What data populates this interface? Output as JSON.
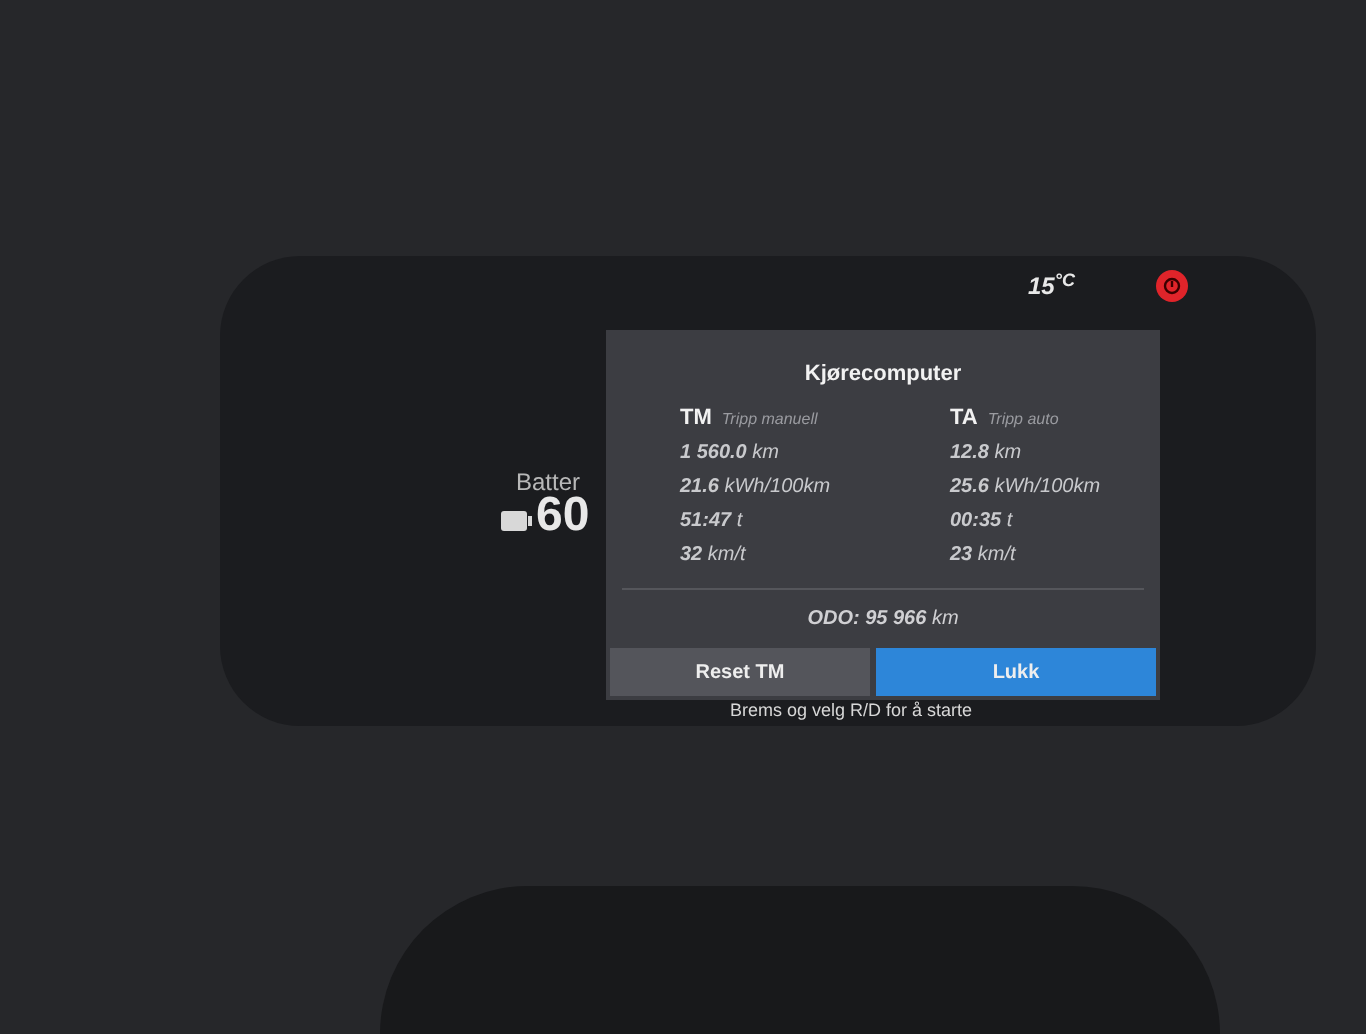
{
  "status": {
    "temperature": "15$^{°C}$"
  },
  "battery": {
    "label": "Batter",
    "value": "60"
  },
  "dialog": {
    "title": "Kjørecomputer",
    "columns": [
      {
        "code": "TM",
        "name": "Tripp manuell",
        "rows": [
          "**1 560.0** km",
          "**21.6** kWh/100km",
          "**51:47** t",
          "**32** km/t"
        ]
      },
      {
        "code": "TA",
        "name": "Tripp auto",
        "rows": [
          "**12.8** km",
          "**25.6** kWh/100km",
          "**00:35** t",
          "**23** km/t"
        ]
      }
    ],
    "odometer": "**ODO: 95 966** km",
    "buttons": [
      {
        "label": "Reset TM",
        "selected": false
      },
      {
        "label": "Lukk",
        "selected": true
      }
    ]
  },
  "hint": "Brems og velg R/D for å starte"
}
